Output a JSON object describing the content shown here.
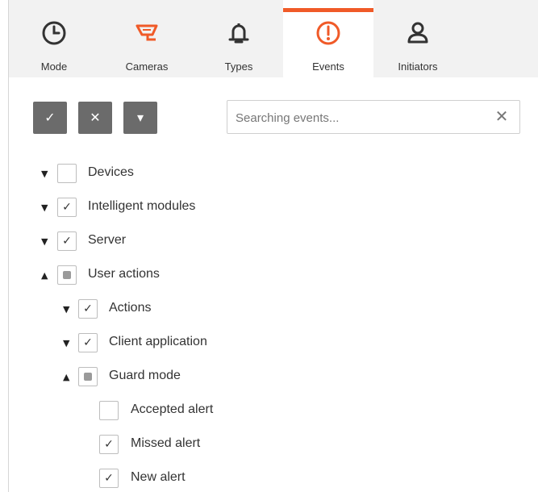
{
  "tabs": [
    {
      "label": "Mode",
      "icon": "clock-icon"
    },
    {
      "label": "Cameras",
      "icon": "camera-icon"
    },
    {
      "label": "Types",
      "icon": "bell-icon"
    },
    {
      "label": "Events",
      "icon": "alert-icon"
    },
    {
      "label": "Initiators",
      "icon": "user-icon"
    }
  ],
  "active_tab": "Events",
  "accent_color": "#f05a28",
  "toolbar": {
    "select_all": "✓",
    "clear_all": "✕",
    "expand": "▾"
  },
  "search": {
    "placeholder": "Searching events...",
    "value": "",
    "clear": "✕"
  },
  "tree": [
    {
      "label": "Devices",
      "state": "unchecked",
      "expand": "collapsed"
    },
    {
      "label": "Intelligent modules",
      "state": "checked",
      "expand": "collapsed"
    },
    {
      "label": "Server",
      "state": "checked",
      "expand": "collapsed"
    },
    {
      "label": "User actions",
      "state": "partial",
      "expand": "expanded"
    },
    {
      "label": "Actions",
      "state": "checked",
      "expand": "collapsed"
    },
    {
      "label": "Client application",
      "state": "checked",
      "expand": "collapsed"
    },
    {
      "label": "Guard mode",
      "state": "partial",
      "expand": "expanded"
    },
    {
      "label": "Accepted alert",
      "state": "unchecked",
      "expand": "none"
    },
    {
      "label": "Missed alert",
      "state": "checked",
      "expand": "none"
    },
    {
      "label": "New alert",
      "state": "checked",
      "expand": "none"
    }
  ]
}
